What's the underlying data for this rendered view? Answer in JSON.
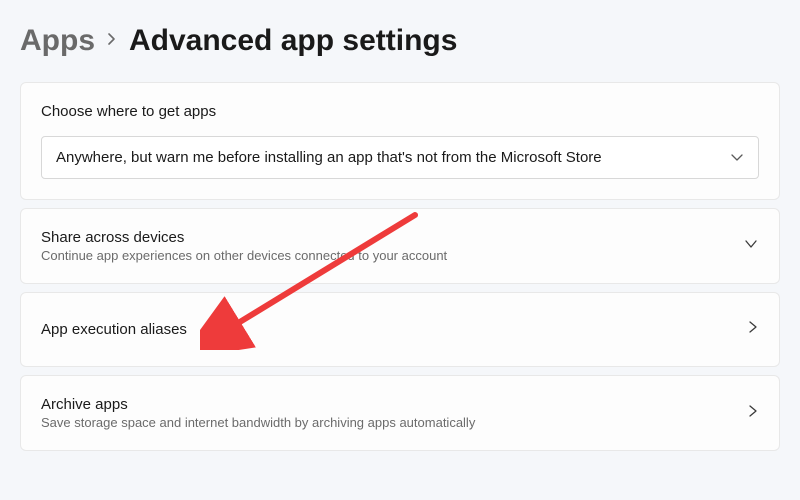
{
  "breadcrumb": {
    "parent": "Apps",
    "current": "Advanced app settings"
  },
  "getAppsPanel": {
    "title": "Choose where to get apps",
    "selected": "Anywhere, but warn me before installing an app that's not from the Microsoft Store"
  },
  "shareDevices": {
    "title": "Share across devices",
    "subtitle": "Continue app experiences on other devices connected to your account"
  },
  "execAliases": {
    "title": "App execution aliases"
  },
  "archiveApps": {
    "title": "Archive apps",
    "subtitle": "Save storage space and internet bandwidth by archiving apps automatically"
  }
}
